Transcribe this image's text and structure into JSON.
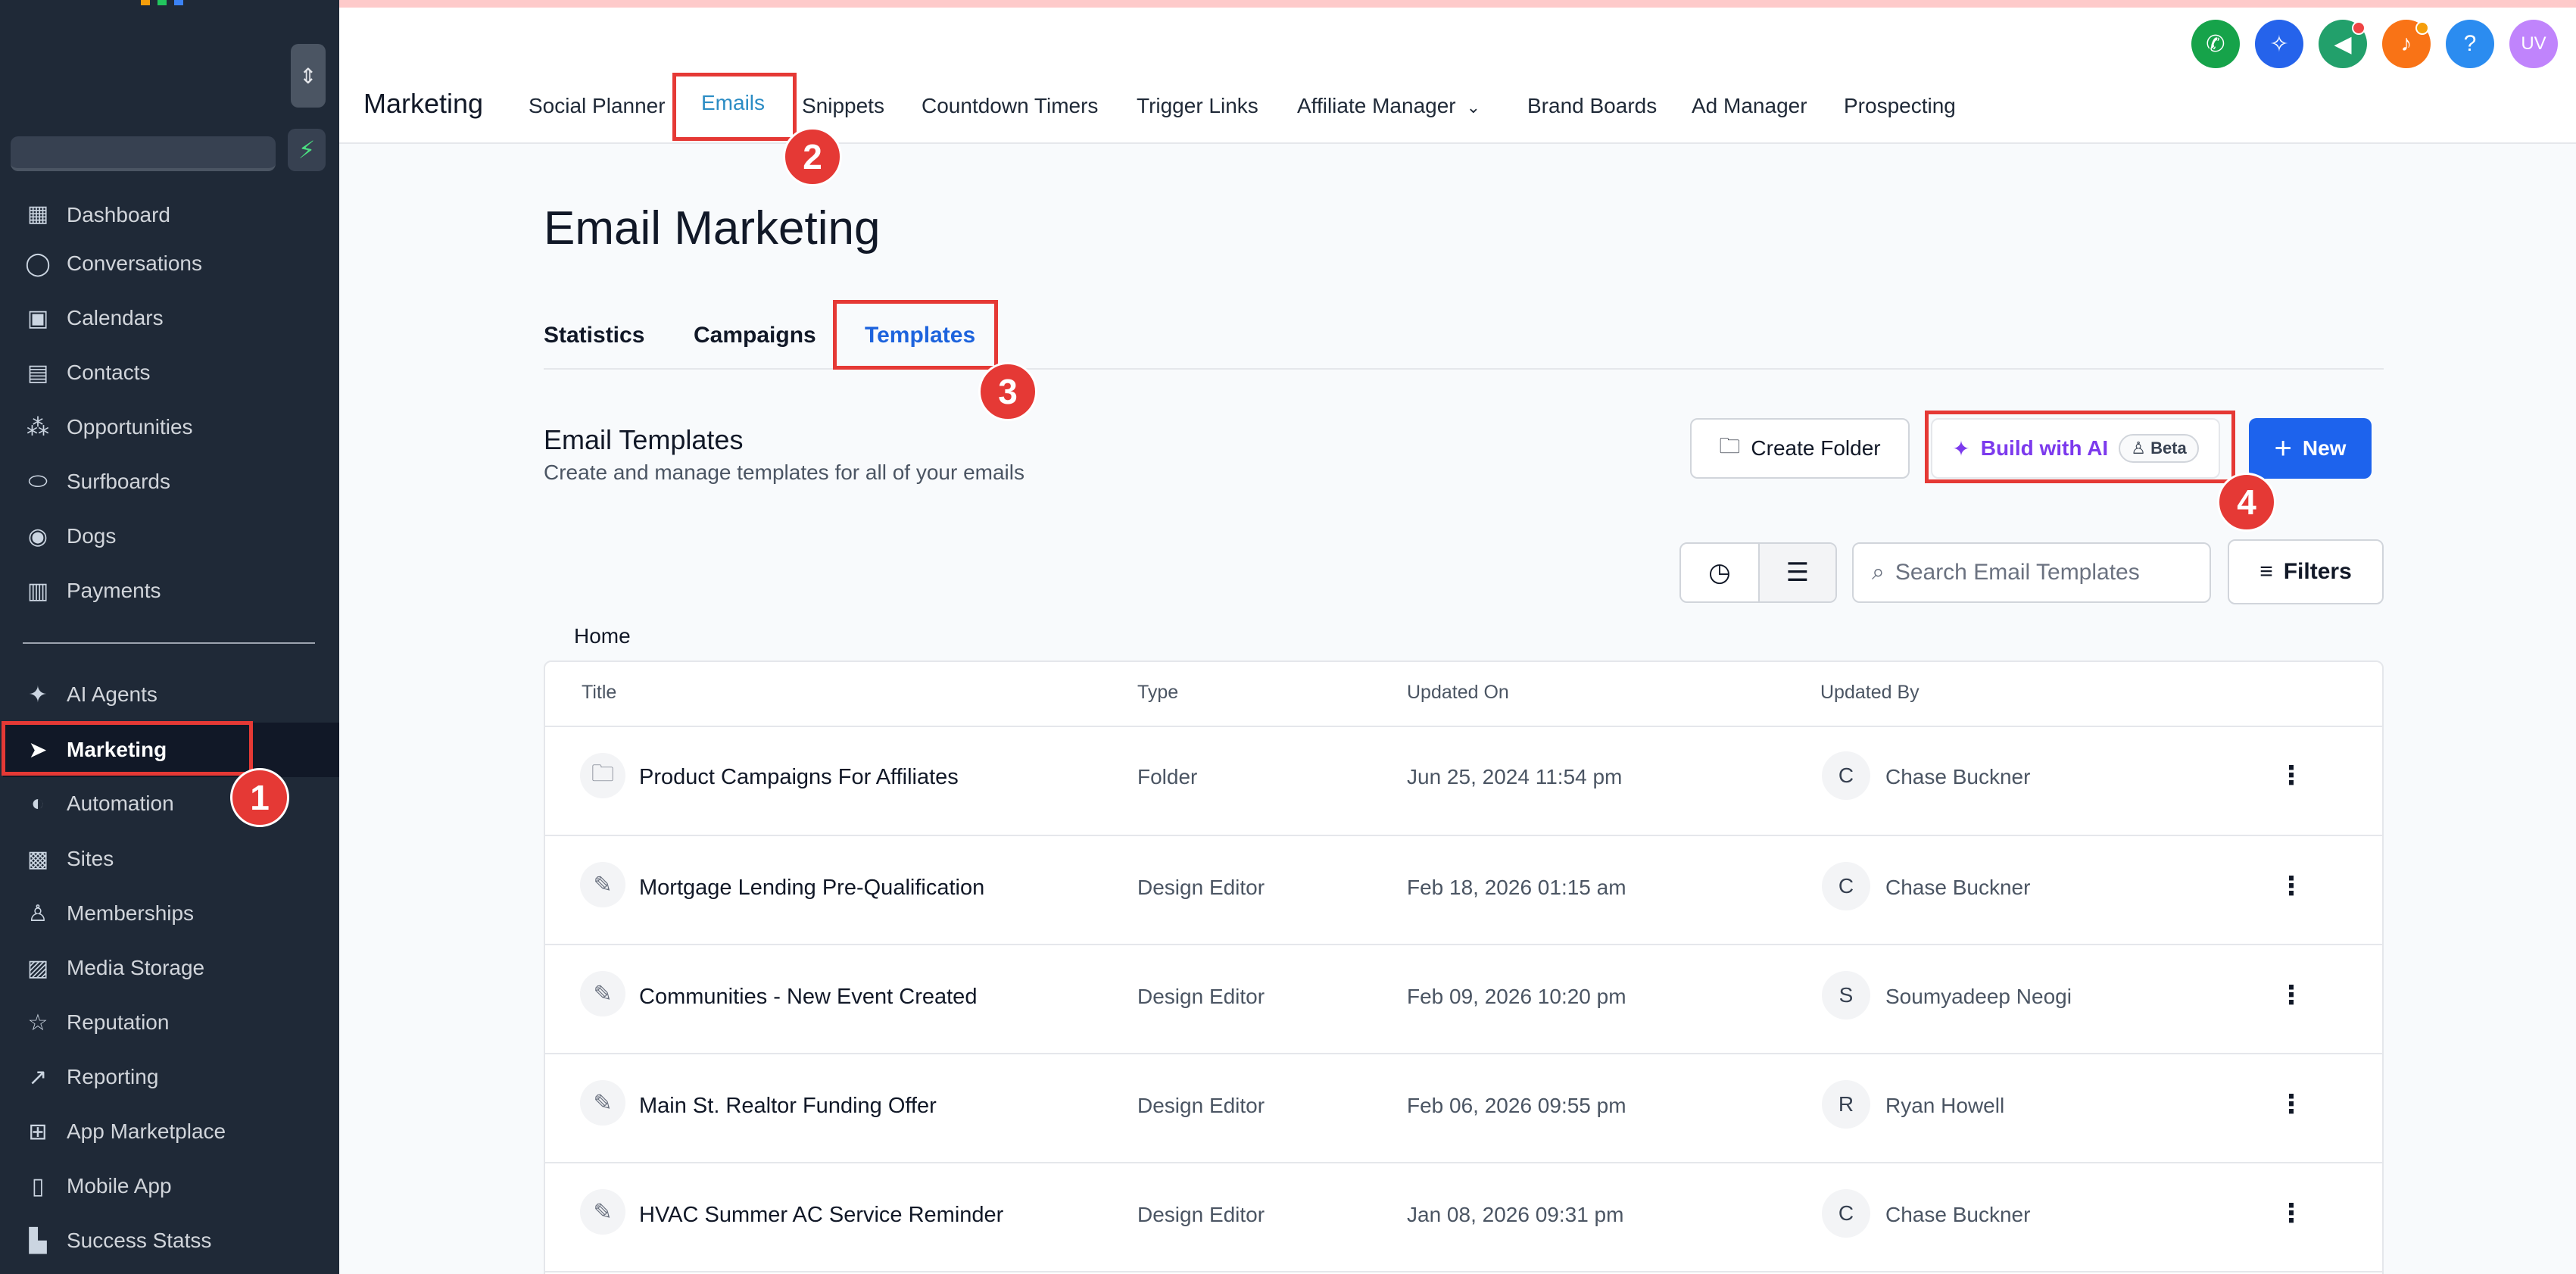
{
  "sidebar": {
    "items": [
      {
        "label": "Dashboard",
        "icon": "dashboard-icon",
        "glyph": "▦"
      },
      {
        "label": "Conversations",
        "icon": "chat-bubble-icon",
        "glyph": "◯"
      },
      {
        "label": "Calendars",
        "icon": "calendar-icon",
        "glyph": "▣"
      },
      {
        "label": "Contacts",
        "icon": "contacts-icon",
        "glyph": "▤"
      },
      {
        "label": "Opportunities",
        "icon": "opportunities-icon",
        "glyph": "⁂"
      },
      {
        "label": "Surfboards",
        "icon": "surfboard-icon",
        "glyph": "⬭"
      },
      {
        "label": "Dogs",
        "icon": "dog-icon",
        "glyph": "◉"
      },
      {
        "label": "Payments",
        "icon": "payments-icon",
        "glyph": "▥"
      },
      {
        "label": "AI Agents",
        "icon": "sparkles-icon",
        "glyph": "✦"
      },
      {
        "label": "Marketing",
        "icon": "paper-plane-icon",
        "glyph": "➤"
      },
      {
        "label": "Automation",
        "icon": "automation-icon",
        "glyph": "◐"
      },
      {
        "label": "Sites",
        "icon": "sites-icon",
        "glyph": "▩"
      },
      {
        "label": "Memberships",
        "icon": "memberships-icon",
        "glyph": "♙"
      },
      {
        "label": "Media Storage",
        "icon": "image-icon",
        "glyph": "▨"
      },
      {
        "label": "Reputation",
        "icon": "star-icon",
        "glyph": "☆"
      },
      {
        "label": "Reporting",
        "icon": "trend-icon",
        "glyph": "↗"
      },
      {
        "label": "App Marketplace",
        "icon": "grid-icon",
        "glyph": "⊞"
      },
      {
        "label": "Mobile App",
        "icon": "mobile-icon",
        "glyph": "▯"
      },
      {
        "label": "Success Statss",
        "icon": "chart-icon",
        "glyph": "▙"
      }
    ]
  },
  "topbar": {
    "app_title": "Marketing",
    "tabs": [
      "Social Planner",
      "Emails",
      "Snippets",
      "Countdown Timers",
      "Trigger Links",
      "Affiliate Manager",
      "Brand Boards",
      "Ad Manager",
      "Prospecting"
    ],
    "avatar_initials": "UV",
    "help_glyph": "?"
  },
  "page": {
    "title": "Email Marketing",
    "subtabs": [
      "Statistics",
      "Campaigns",
      "Templates"
    ],
    "section_title": "Email Templates",
    "section_subtitle": "Create and manage templates for all of your emails",
    "create_folder": "Create Folder",
    "build_ai": "Build with AI",
    "beta": "Beta",
    "new": "New",
    "search_placeholder": "Search Email Templates",
    "filters": "Filters",
    "breadcrumb": "Home"
  },
  "table": {
    "columns": [
      "Title",
      "Type",
      "Updated On",
      "Updated By"
    ],
    "rows": [
      {
        "title": "Product Campaigns For Affiliates",
        "type": "Folder",
        "updated_on": "Jun 25, 2024 11:54 pm",
        "initial": "C",
        "updated_by": "Chase Buckner",
        "icon": "folder-icon"
      },
      {
        "title": "Mortgage Lending Pre-Qualification",
        "type": "Design Editor",
        "updated_on": "Feb 18, 2026 01:15 am",
        "initial": "C",
        "updated_by": "Chase Buckner",
        "icon": "brush-icon"
      },
      {
        "title": "Communities - New Event Created",
        "type": "Design Editor",
        "updated_on": "Feb 09, 2026 10:20 pm",
        "initial": "S",
        "updated_by": "Soumyadeep Neogi",
        "icon": "brush-icon"
      },
      {
        "title": "Main St. Realtor Funding Offer",
        "type": "Design Editor",
        "updated_on": "Feb 06, 2026 09:55 pm",
        "initial": "R",
        "updated_by": "Ryan Howell",
        "icon": "brush-icon"
      },
      {
        "title": "HVAC Summer AC Service Reminder",
        "type": "Design Editor",
        "updated_on": "Jan 08, 2026 09:31 pm",
        "initial": "C",
        "updated_by": "Chase Buckner",
        "icon": "brush-icon"
      }
    ]
  },
  "annotations": [
    "1",
    "2",
    "3",
    "4"
  ],
  "colors": {
    "accent_blue": "#1d63ed",
    "annotation_red": "#e53935",
    "ai_purple": "#7c3aed",
    "sidebar_bg": "#1f2937"
  }
}
